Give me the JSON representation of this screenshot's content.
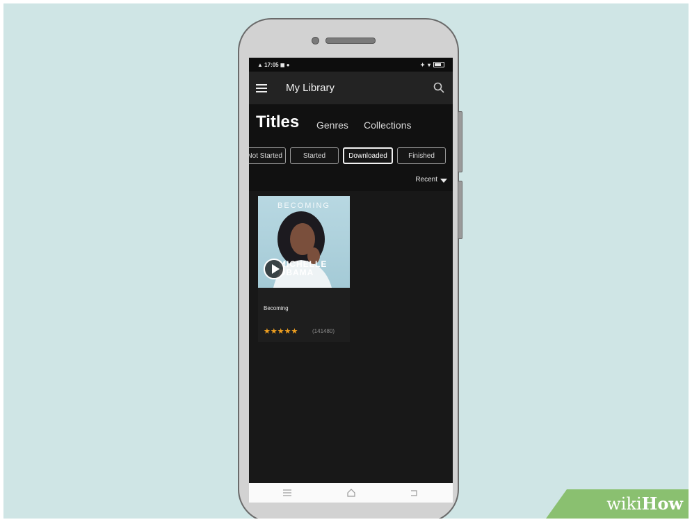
{
  "status_bar": {
    "time": "17:05"
  },
  "app_bar": {
    "title": "My Library"
  },
  "tabs": [
    {
      "label": "Titles",
      "active": true
    },
    {
      "label": "Genres",
      "active": false
    },
    {
      "label": "Collections",
      "active": false
    }
  ],
  "filters": [
    {
      "label": "Not Started",
      "active": false
    },
    {
      "label": "Started",
      "active": false
    },
    {
      "label": "Downloaded",
      "active": true
    },
    {
      "label": "Finished",
      "active": false
    }
  ],
  "sort": {
    "label": "Recent"
  },
  "books": [
    {
      "title": "Becoming",
      "cover_title": "BECOMING",
      "cover_author_line1": "MICHELLE",
      "cover_author_line2": "OBAMA",
      "stars": "★★★★★",
      "rating_count": "(141480)",
      "star_color": "#f0a020"
    }
  ],
  "watermark": {
    "wiki": "wiki",
    "how": "How"
  },
  "colors": {
    "background": "#cfe5e5",
    "app_dark": "#181818",
    "accent_star": "#f0a020"
  }
}
